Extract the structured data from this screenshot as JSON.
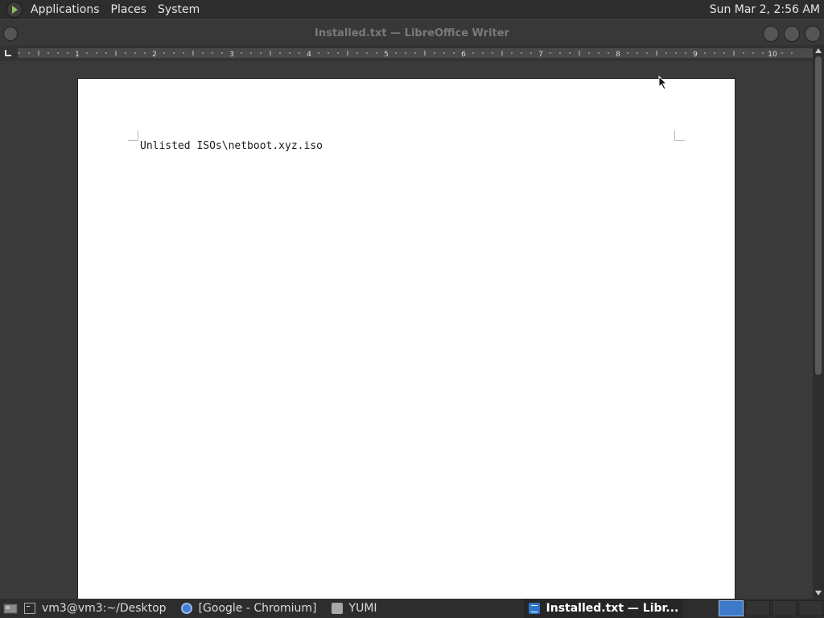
{
  "top_panel": {
    "menu": [
      {
        "label": "Applications"
      },
      {
        "label": "Places"
      },
      {
        "label": "System"
      }
    ],
    "clock": "Sun Mar 2, 2:56 AM"
  },
  "window": {
    "title": "Installed.txt — LibreOffice Writer"
  },
  "ruler": {
    "labels": [
      "1",
      "2",
      "3",
      "4",
      "5",
      "6",
      "7",
      "8",
      "9",
      "10"
    ]
  },
  "document": {
    "text": "Unlisted ISOs\\netboot.xyz.iso"
  },
  "taskbar": {
    "tasks": [
      {
        "label": "vm3@vm3:~/Desktop",
        "icon": "terminal-icon",
        "active": false
      },
      {
        "label": "[Google - Chromium]",
        "icon": "chromium-icon",
        "active": false
      },
      {
        "label": "YUMI",
        "icon": "folder-icon",
        "active": false
      },
      {
        "label": "Installed.txt — Libr...",
        "icon": "writer-icon",
        "active": true
      }
    ],
    "workspaces": 4,
    "active_workspace": 1
  },
  "colors": {
    "panel_bg": "#2d2d2d",
    "workspace_active": "#3d79c9"
  }
}
